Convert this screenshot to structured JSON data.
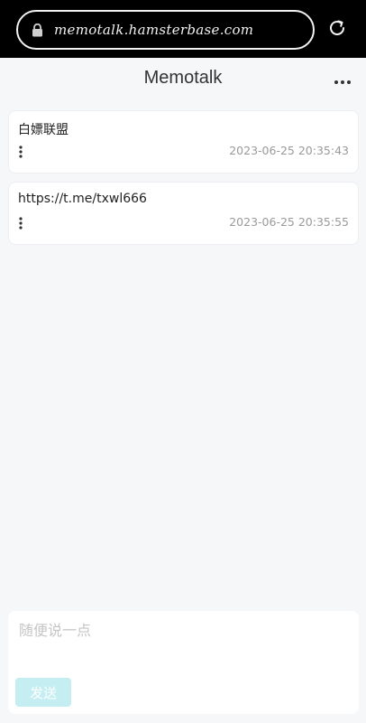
{
  "browser": {
    "url": "memotalk.hamsterbase.com"
  },
  "app": {
    "title": "Memotalk"
  },
  "memos": [
    {
      "text": "白嫖联盟",
      "timestamp": "2023-06-25 20:35:43"
    },
    {
      "text": "https://t.me/txwl666",
      "timestamp": "2023-06-25 20:35:55"
    }
  ],
  "composer": {
    "placeholder": "随便说一点",
    "send_label": "发送"
  },
  "colors": {
    "background": "#f6f7f9",
    "card": "#ffffff",
    "send_button_disabled": "#c4eef2",
    "timestamp": "#9a9a9a"
  },
  "icons": {
    "lock": "lock-icon",
    "reload": "reload-icon",
    "more": "more-horizontal-icon",
    "memo_menu": "more-vertical-icon"
  }
}
